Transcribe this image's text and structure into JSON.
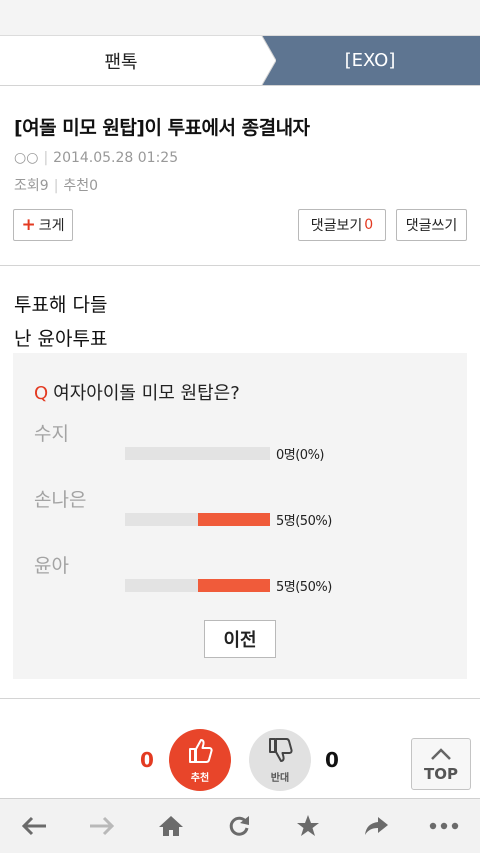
{
  "breadcrumb": {
    "left": "팬톡",
    "right": "[EXO]"
  },
  "post": {
    "title": "[여돌 미모 원탑]이 투표에서 종결내자",
    "author": "○○",
    "date": "2014.05.28 01:25",
    "views_label": "조회",
    "views": "9",
    "recommend_label": "추천",
    "recommend": "0",
    "body_lines": [
      "투표해 다들",
      "난 윤아투표"
    ]
  },
  "buttons": {
    "enlarge": "크게",
    "enlarge_plus": "+",
    "comment_view": "댓글보기",
    "comment_count": "0",
    "comment_write": "댓글쓰기",
    "prev": "이전"
  },
  "poll": {
    "q_mark": "Q",
    "question": "여자아이돌 미모 원탑은?",
    "options": [
      {
        "name": "수지",
        "result": "0명(0%)",
        "percent": 0
      },
      {
        "name": "손나은",
        "result": "5명(50%)",
        "percent": 50
      },
      {
        "name": "윤아",
        "result": "5명(50%)",
        "percent": 50
      }
    ]
  },
  "vote": {
    "up_count": "0",
    "up_label": "추천",
    "down_count": "0",
    "down_label": "반대"
  },
  "top_label": "TOP",
  "colors": {
    "accent": "#e33a21",
    "crumb_bg": "#5e7591",
    "bar_fill": "#f05b3a"
  },
  "toolbar_icons": [
    "back-icon",
    "forward-icon",
    "home-icon",
    "refresh-icon",
    "star-icon",
    "share-icon",
    "more-icon"
  ]
}
